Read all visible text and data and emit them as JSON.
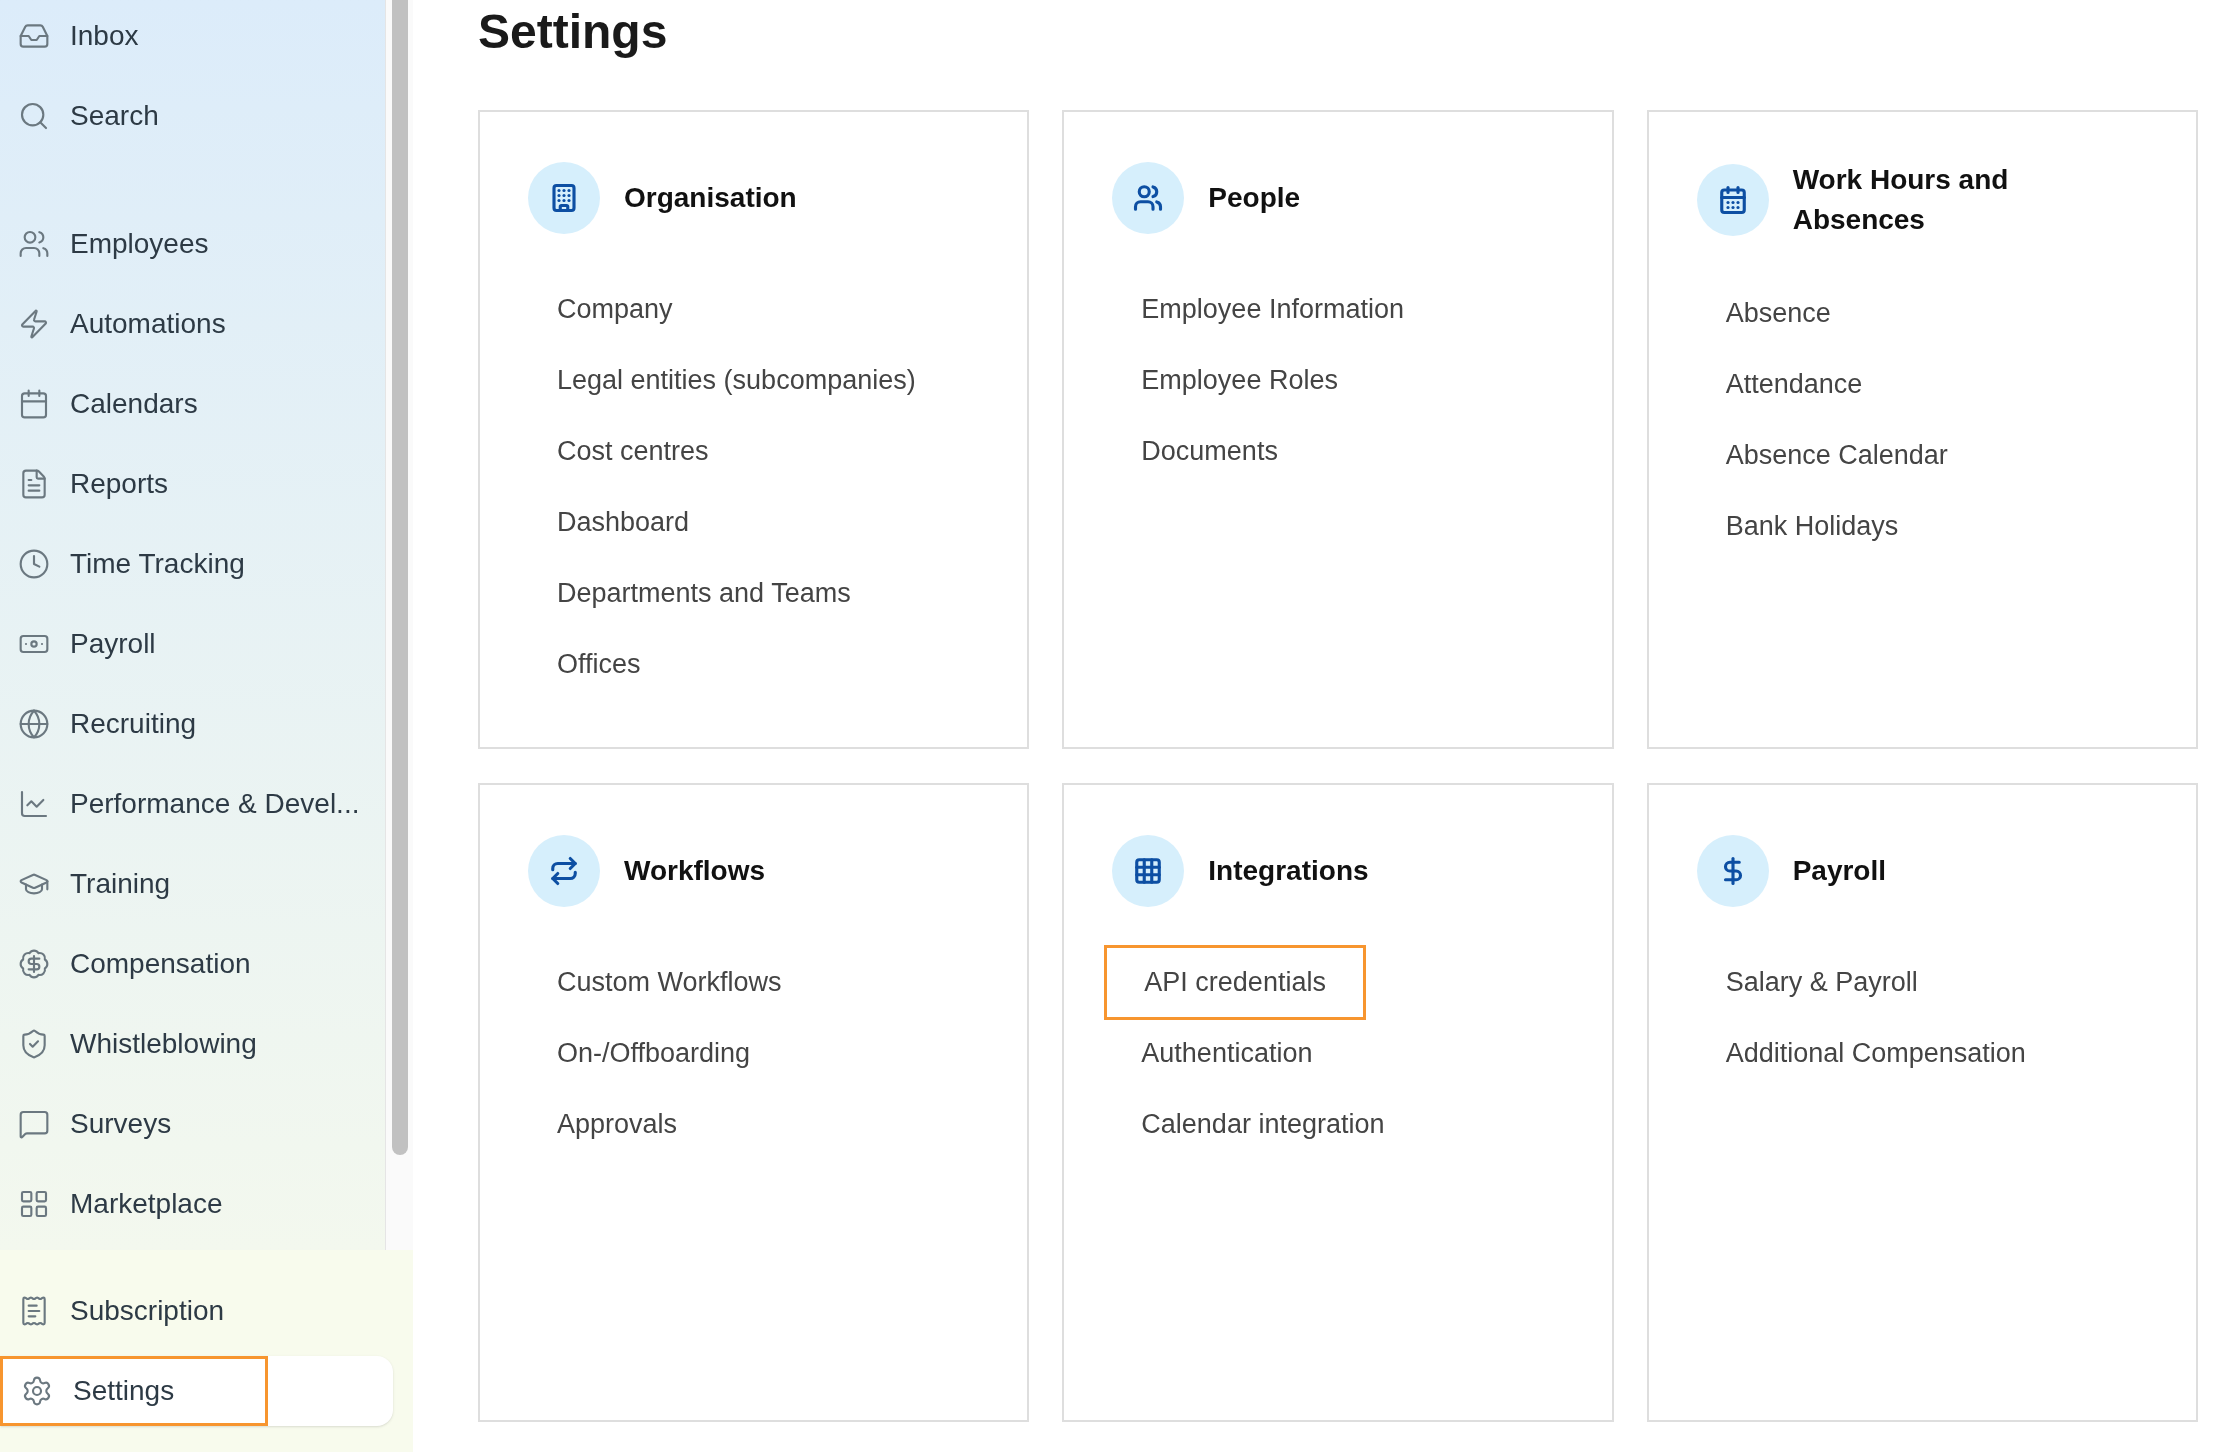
{
  "sidebar": {
    "items": [
      {
        "label": "Inbox",
        "selected": false,
        "highlighted": false
      },
      {
        "label": "Search",
        "selected": false,
        "highlighted": false
      },
      {
        "label": "Employees",
        "selected": false,
        "highlighted": false
      },
      {
        "label": "Automations",
        "selected": false,
        "highlighted": false
      },
      {
        "label": "Calendars",
        "selected": false,
        "highlighted": false
      },
      {
        "label": "Reports",
        "selected": false,
        "highlighted": false
      },
      {
        "label": "Time Tracking",
        "selected": false,
        "highlighted": false
      },
      {
        "label": "Payroll",
        "selected": false,
        "highlighted": false
      },
      {
        "label": "Recruiting",
        "selected": false,
        "highlighted": false
      },
      {
        "label": "Performance & Devel...",
        "selected": false,
        "highlighted": false
      },
      {
        "label": "Training",
        "selected": false,
        "highlighted": false
      },
      {
        "label": "Compensation",
        "selected": false,
        "highlighted": false
      },
      {
        "label": "Whistleblowing",
        "selected": false,
        "highlighted": false
      },
      {
        "label": "Surveys",
        "selected": false,
        "highlighted": false
      },
      {
        "label": "Marketplace",
        "selected": false,
        "highlighted": false
      }
    ],
    "footer_items": [
      {
        "label": "Subscription",
        "selected": false,
        "highlighted": false
      },
      {
        "label": "Settings",
        "selected": true,
        "highlighted": true
      }
    ]
  },
  "page": {
    "title": "Settings"
  },
  "cards": [
    {
      "title": "Organisation",
      "links": [
        {
          "label": "Company",
          "highlighted": false
        },
        {
          "label": "Legal entities (subcompanies)",
          "highlighted": false
        },
        {
          "label": "Cost centres",
          "highlighted": false
        },
        {
          "label": "Dashboard",
          "highlighted": false
        },
        {
          "label": "Departments and Teams",
          "highlighted": false
        },
        {
          "label": "Offices",
          "highlighted": false
        }
      ]
    },
    {
      "title": "People",
      "links": [
        {
          "label": "Employee Information",
          "highlighted": false
        },
        {
          "label": "Employee Roles",
          "highlighted": false
        },
        {
          "label": "Documents",
          "highlighted": false
        }
      ]
    },
    {
      "title": "Work Hours and Absences",
      "links": [
        {
          "label": "Absence",
          "highlighted": false
        },
        {
          "label": "Attendance",
          "highlighted": false
        },
        {
          "label": "Absence Calendar",
          "highlighted": false
        },
        {
          "label": "Bank Holidays",
          "highlighted": false
        }
      ]
    },
    {
      "title": "Workflows",
      "links": [
        {
          "label": "Custom Workflows",
          "highlighted": false
        },
        {
          "label": "On-/Offboarding",
          "highlighted": false
        },
        {
          "label": "Approvals",
          "highlighted": false
        }
      ]
    },
    {
      "title": "Integrations",
      "links": [
        {
          "label": "API credentials",
          "highlighted": true
        },
        {
          "label": "Authentication",
          "highlighted": false
        },
        {
          "label": "Calendar integration",
          "highlighted": false
        }
      ]
    },
    {
      "title": "Payroll",
      "links": [
        {
          "label": "Salary & Payroll",
          "highlighted": false
        },
        {
          "label": "Additional Compensation",
          "highlighted": false
        }
      ]
    }
  ]
}
